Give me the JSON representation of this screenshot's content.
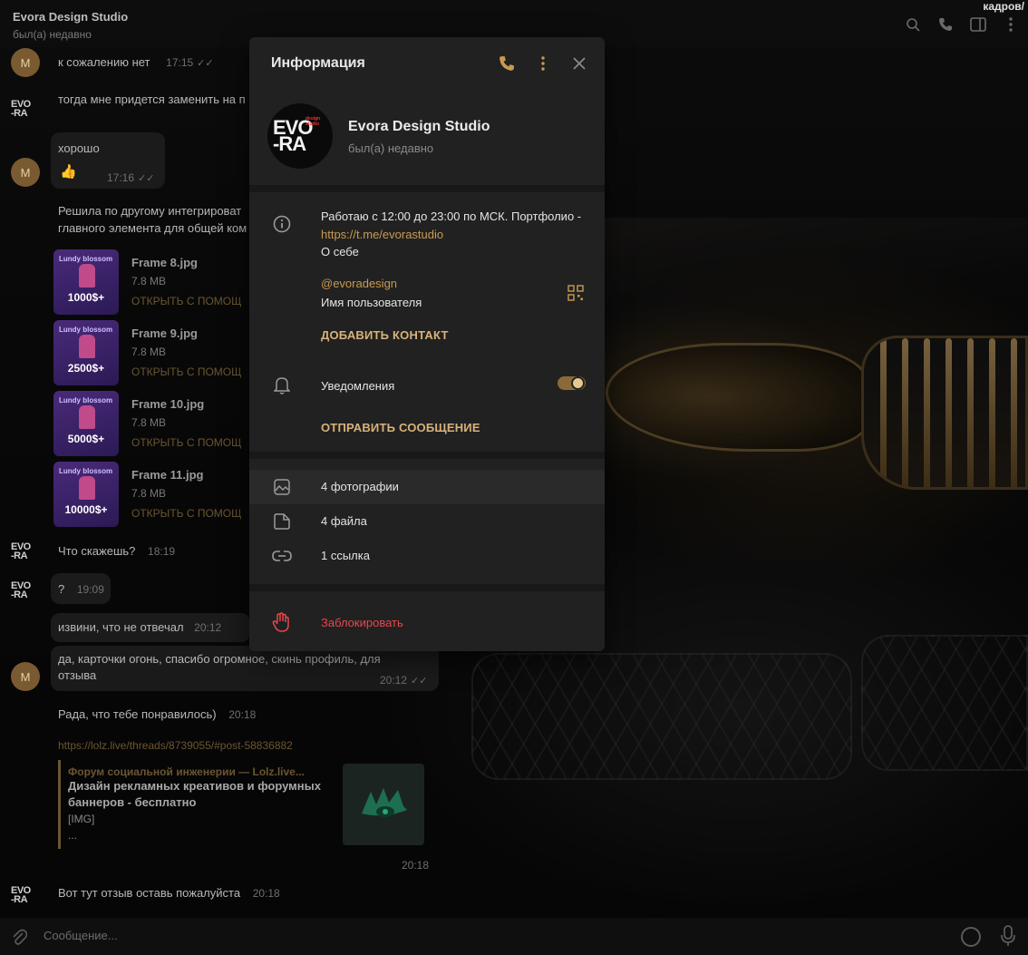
{
  "header": {
    "chat_title": "Evora Design Studio",
    "chat_status": "был(а) недавно",
    "corner_text": "кадров/"
  },
  "chat": {
    "messages": [
      {
        "text": "к сожалению нет",
        "time": "17:15"
      },
      {
        "text": "тогда мне придется заменить на п"
      },
      {
        "text": "хорошо"
      },
      {
        "emoji": "👍",
        "time": "17:16"
      },
      {
        "text": "Решила по другому интегрироват"
      },
      {
        "text": "главного элемента для общей ком"
      },
      {
        "text": "Что скажешь?",
        "time": "18:19"
      },
      {
        "text": "?",
        "time": "19:09"
      },
      {
        "text": "извини, что не отвечал",
        "time": "20:12"
      },
      {
        "text": "да, карточки огонь, спасибо огромное, скинь профиль, для",
        "time": "20:12"
      },
      {
        "text": "отзыва"
      },
      {
        "text": "Рада, что тебе понравилось)",
        "time": "20:18"
      },
      {
        "text": "https://lolz.live/threads/8739055/#post-58836882"
      },
      {
        "text": "Вот тут отзыв оставь пожалуйста",
        "time": "20:18"
      }
    ],
    "avatar_letter": "M",
    "files": [
      {
        "name": "Frame 8.jpg",
        "size": "7.8 MB",
        "open": "ОТКРЫТЬ С ПОМОЩ",
        "badge": "1000$+"
      },
      {
        "name": "Frame 9.jpg",
        "size": "7.8 MB",
        "open": "ОТКРЫТЬ С ПОМОЩ",
        "badge": "2500$+"
      },
      {
        "name": "Frame 10.jpg",
        "size": "7.8 MB",
        "open": "ОТКРЫТЬ С ПОМОЩ",
        "badge": "5000$+"
      },
      {
        "name": "Frame 11.jpg",
        "size": "7.8 MB",
        "open": "ОТКРЫТЬ С ПОМОЩ",
        "badge": "10000$+"
      }
    ],
    "thumb_caption": "Lundy blossom",
    "preview": {
      "site": "Форум социальной инженерии — Lolz.live...",
      "title": "Дизайн рекламных креативов и форумных баннеров - бесплатно",
      "body1": "[IMG]",
      "body2": "...",
      "time": "20:18"
    }
  },
  "composer": {
    "placeholder": "Сообщение..."
  },
  "info_panel": {
    "title": "Информация",
    "name": "Evora Design Studio",
    "status": "был(а) недавно",
    "avatar_text": "EVO-RA",
    "avatar_tag": "design studio",
    "bio_text": "Работаю с 12:00 до 23:00 по МСК. Портфолио - ",
    "bio_link": "https://t.me/evorastudio",
    "bio_label": "О себе",
    "username": "@evoradesign",
    "username_label": "Имя пользователя",
    "add_contact": "ДОБАВИТЬ КОНТАКТ",
    "notifications": "Уведомления",
    "notifications_on": true,
    "send_message": "ОТПРАВИТЬ СООБЩЕНИЕ",
    "media": [
      {
        "label": "4 фотографии",
        "icon": "photo-icon"
      },
      {
        "label": "4 файла",
        "icon": "file-icon"
      },
      {
        "label": "1 ссылка",
        "icon": "link-icon"
      }
    ],
    "block": "Заблокировать"
  },
  "colors": {
    "accent": "#c99a50",
    "danger": "#e5484d",
    "panel": "#212121"
  }
}
